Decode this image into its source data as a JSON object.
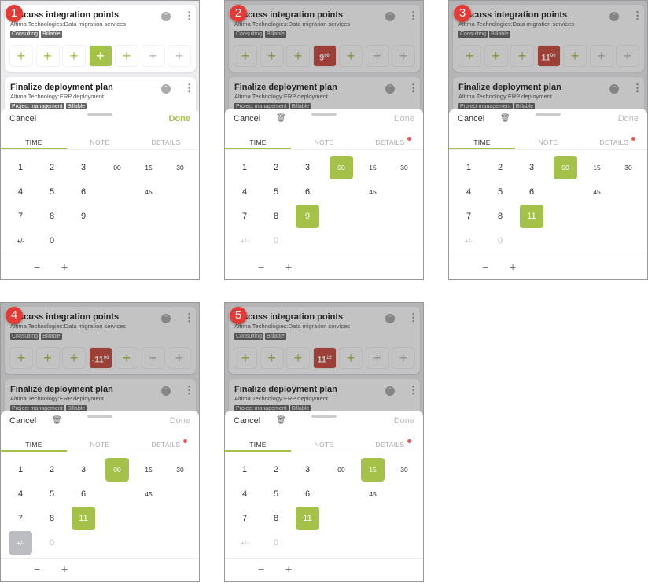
{
  "colors": {
    "accent": "#a4c24a",
    "entry_error": "#c94a3d",
    "badge": "#e53935"
  },
  "cards": [
    {
      "title": "Discuss integration points",
      "subtitle": "Altima Technologies:Data migration services",
      "tags": [
        "Consulting",
        "Billable"
      ],
      "status_icon": "chevron-up-icon",
      "menu_icon": "kebab-icon"
    },
    {
      "title": "Finalize deployment plan",
      "subtitle": "Altima Technology:ERP deployment",
      "tags": [
        "Project management",
        "Billable"
      ],
      "status_icon": "chevron-up-icon",
      "menu_icon": "kebab-icon"
    }
  ],
  "day_button_label": "+",
  "sheet": {
    "cancel": "Cancel",
    "done": "Done",
    "tabs": [
      "TIME",
      "NOTE",
      "DETAILS"
    ],
    "hour_keys": [
      "1",
      "2",
      "3",
      "4",
      "5",
      "6",
      "7",
      "8",
      "9",
      "+/-",
      "0"
    ],
    "minute_keys": [
      "00",
      "15",
      "30",
      "45"
    ],
    "stepper": [
      "−",
      "+"
    ]
  },
  "panels": [
    {
      "step": "1",
      "entry_hours": "",
      "entry_minutes": "",
      "done_enabled": true,
      "trash": false,
      "details_dot": false,
      "selected_hour": null,
      "selected_minute": null,
      "sign_active": false
    },
    {
      "step": "2",
      "entry_hours": "9",
      "entry_minutes": "00",
      "done_enabled": false,
      "trash": true,
      "details_dot": true,
      "selected_hour": "9",
      "selected_minute": "00",
      "sign_active": false
    },
    {
      "step": "3",
      "entry_hours": "11",
      "entry_minutes": "00",
      "done_enabled": false,
      "trash": true,
      "details_dot": true,
      "selected_hour": "11",
      "selected_minute": "00",
      "sign_active": false
    },
    {
      "step": "4",
      "entry_hours": "-11",
      "entry_minutes": "00",
      "done_enabled": false,
      "trash": true,
      "details_dot": true,
      "selected_hour": "11",
      "selected_minute": "00",
      "sign_active": true
    },
    {
      "step": "5",
      "entry_hours": "11",
      "entry_minutes": "15",
      "done_enabled": false,
      "trash": true,
      "details_dot": true,
      "selected_hour": "11",
      "selected_minute": "15",
      "sign_active": false
    }
  ]
}
